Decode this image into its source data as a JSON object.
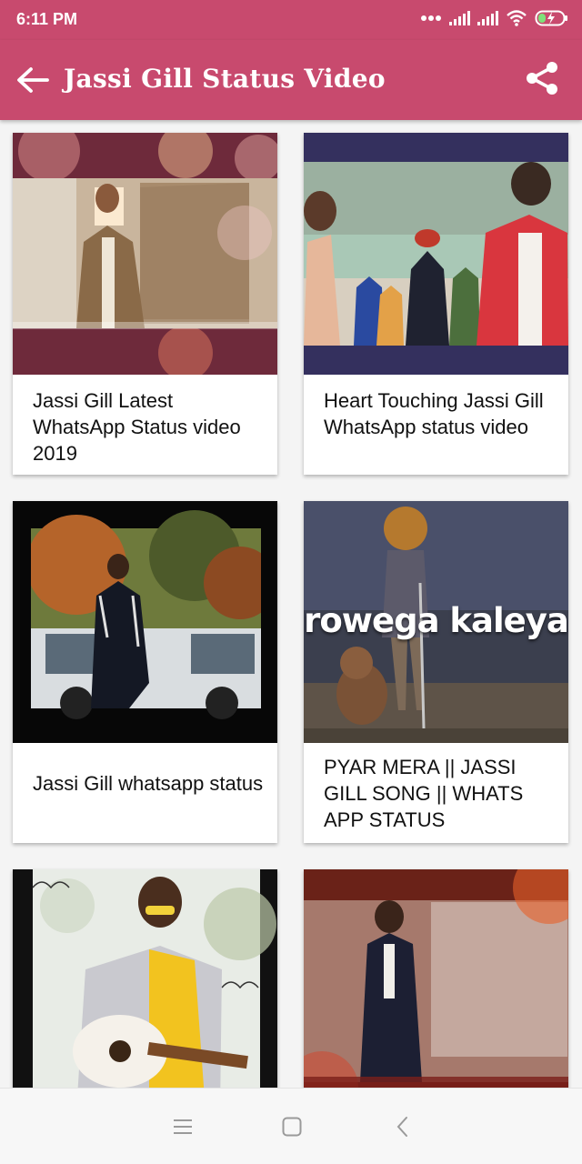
{
  "status_bar": {
    "time": "6:11 PM",
    "icons": [
      "dots-icon",
      "signal-icon",
      "signal-icon",
      "wifi-icon",
      "battery-charging-icon"
    ]
  },
  "app_bar": {
    "title": "Jassi Gill Status Video",
    "back_icon": "back-arrow-icon",
    "share_icon": "share-icon",
    "color": "#c84a6e"
  },
  "videos": [
    {
      "title": "Jassi Gill Latest WhatsApp Status video 2019"
    },
    {
      "title": "Heart Touching Jassi Gill WhatsApp status video"
    },
    {
      "title": "Jassi Gill whatsapp status"
    },
    {
      "title": "PYAR MERA || JASSI GILL SONG || WHATS APP STATUS",
      "overlay_text": "rowega kaleya"
    },
    {
      "title": ""
    },
    {
      "title": ""
    }
  ],
  "nav_bar": {
    "icons": [
      "menu-icon",
      "home-square-icon",
      "back-triangle-icon"
    ]
  }
}
